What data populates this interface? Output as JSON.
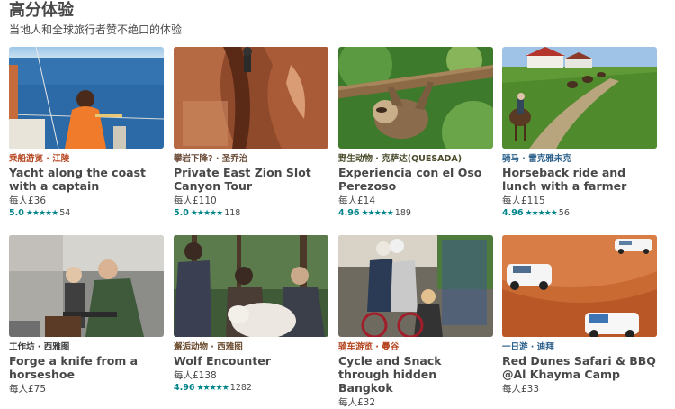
{
  "section": {
    "title": "高分体验",
    "subtitle": "当地人和全球旅行者赞不绝口的体验"
  },
  "colors": {
    "rating": "#008489",
    "text": "#484848"
  },
  "cards": [
    {
      "category": "乘船游览 · 江陵",
      "category_color": "#b4421d",
      "title": "Yacht along the coast with a captain",
      "price": "每人£36",
      "score": "5.0",
      "stars": 5,
      "reviews": "54",
      "photo": "sea-yacht"
    },
    {
      "category": "攀岩下降? · 圣乔治",
      "category_color": "#6b4c38",
      "title": "Private East Zion Slot Canyon Tour",
      "price": "每人£110",
      "score": "5.0",
      "stars": 5,
      "reviews": "118",
      "photo": "canyon"
    },
    {
      "category": "野生动物 · 克萨达(QUESADA)",
      "category_color": "#4b4b2b",
      "title": "Experiencia con el Oso Perezoso",
      "price": "每人£14",
      "score": "4.96",
      "stars": 5,
      "reviews": "189",
      "photo": "sloth"
    },
    {
      "category": "骑马 · 雷克雅未克",
      "category_color": "#2a5f8a",
      "title": "Horseback ride and lunch with a farmer",
      "price": "每人£115",
      "score": "4.96",
      "stars": 5,
      "reviews": "56",
      "photo": "horses"
    },
    {
      "category": "工作坊 · 西雅图",
      "category_color": "#3d3d3d",
      "title": "Forge a knife from a horseshoe",
      "price": "每人£75",
      "score": "",
      "stars": 0,
      "reviews": "",
      "photo": "forge"
    },
    {
      "category": "邂逅动物 · 西雅图",
      "category_color": "#6b4b2e",
      "title": "Wolf Encounter",
      "price": "每人£138",
      "score": "4.96",
      "stars": 5,
      "reviews": "1282",
      "photo": "wolf"
    },
    {
      "category": "骑车游览 · 曼谷",
      "category_color": "#b4421d",
      "title": "Cycle and Snack through hidden Bangkok",
      "price": "每人£32",
      "score": "",
      "stars": 0,
      "reviews": "",
      "photo": "bikes"
    },
    {
      "category": "一日游 · 迪拜",
      "category_color": "#2a5f8a",
      "title": "Red Dunes Safari & BBQ @Al Khayma Camp",
      "price": "每人£33",
      "score": "",
      "stars": 0,
      "reviews": "",
      "photo": "dunes"
    }
  ]
}
